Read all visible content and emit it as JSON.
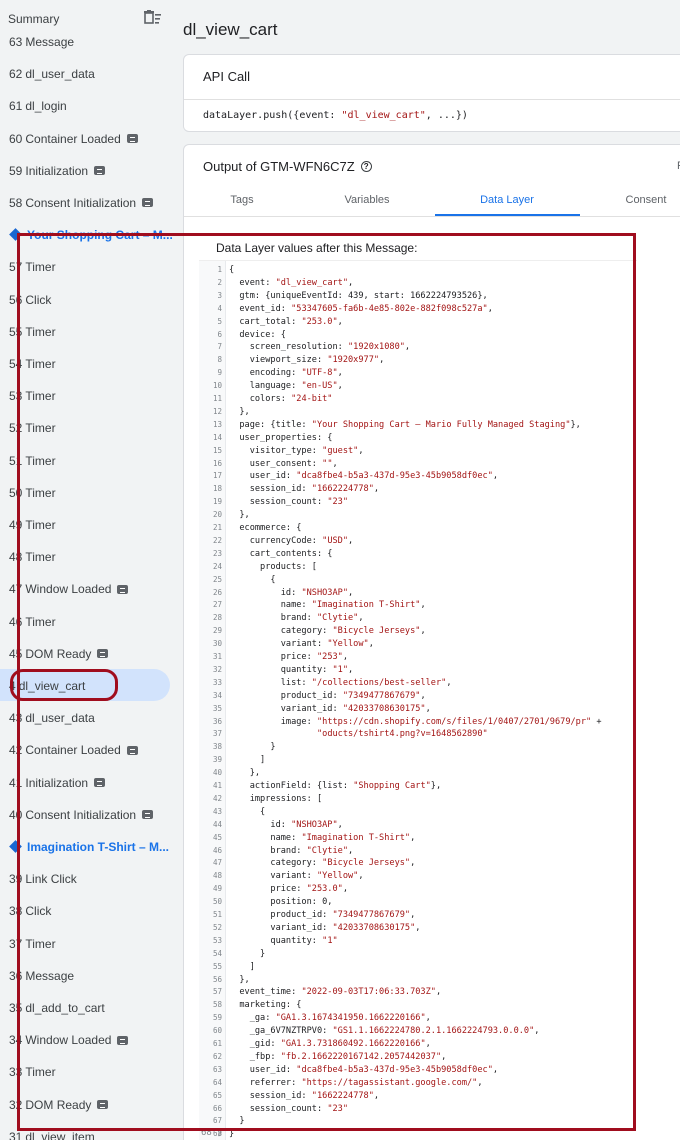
{
  "sidebar": {
    "title": "Summary",
    "clear_icon": "clear-list-icon",
    "items": [
      {
        "num": "63",
        "label": "Message",
        "badge": false,
        "type": "event"
      },
      {
        "num": "62",
        "label": "dl_user_data",
        "badge": false,
        "type": "event"
      },
      {
        "num": "61",
        "label": "dl_login",
        "badge": false,
        "type": "event"
      },
      {
        "num": "60",
        "label": "Container Loaded",
        "badge": true,
        "type": "event"
      },
      {
        "num": "59",
        "label": "Initialization",
        "badge": true,
        "type": "event"
      },
      {
        "num": "58",
        "label": "Consent Initialization",
        "badge": true,
        "type": "event"
      },
      {
        "num": "",
        "label": "Your Shopping Cart – M...",
        "badge": false,
        "type": "page"
      },
      {
        "num": "57",
        "label": "Timer",
        "badge": false,
        "type": "event"
      },
      {
        "num": "56",
        "label": "Click",
        "badge": false,
        "type": "event"
      },
      {
        "num": "55",
        "label": "Timer",
        "badge": false,
        "type": "event"
      },
      {
        "num": "54",
        "label": "Timer",
        "badge": false,
        "type": "event"
      },
      {
        "num": "53",
        "label": "Timer",
        "badge": false,
        "type": "event"
      },
      {
        "num": "52",
        "label": "Timer",
        "badge": false,
        "type": "event"
      },
      {
        "num": "51",
        "label": "Timer",
        "badge": false,
        "type": "event"
      },
      {
        "num": "50",
        "label": "Timer",
        "badge": false,
        "type": "event"
      },
      {
        "num": "49",
        "label": "Timer",
        "badge": false,
        "type": "event"
      },
      {
        "num": "48",
        "label": "Timer",
        "badge": false,
        "type": "event"
      },
      {
        "num": "47",
        "label": "Window Loaded",
        "badge": true,
        "type": "event"
      },
      {
        "num": "46",
        "label": "Timer",
        "badge": false,
        "type": "event"
      },
      {
        "num": "45",
        "label": "DOM Ready",
        "badge": true,
        "type": "event"
      },
      {
        "num": "4",
        "label": "dl_view_cart",
        "badge": false,
        "type": "selected"
      },
      {
        "num": "43",
        "label": "dl_user_data",
        "badge": false,
        "type": "event"
      },
      {
        "num": "42",
        "label": "Container Loaded",
        "badge": true,
        "type": "event"
      },
      {
        "num": "41",
        "label": "Initialization",
        "badge": true,
        "type": "event"
      },
      {
        "num": "40",
        "label": "Consent Initialization",
        "badge": true,
        "type": "event"
      },
      {
        "num": "",
        "label": "Imagination T-Shirt – M...",
        "badge": false,
        "type": "page"
      },
      {
        "num": "39",
        "label": "Link Click",
        "badge": false,
        "type": "event"
      },
      {
        "num": "38",
        "label": "Click",
        "badge": false,
        "type": "event"
      },
      {
        "num": "37",
        "label": "Timer",
        "badge": false,
        "type": "event"
      },
      {
        "num": "36",
        "label": "Message",
        "badge": false,
        "type": "event"
      },
      {
        "num": "35",
        "label": "dl_add_to_cart",
        "badge": false,
        "type": "event"
      },
      {
        "num": "34",
        "label": "Window Loaded",
        "badge": true,
        "type": "event"
      },
      {
        "num": "33",
        "label": "Timer",
        "badge": false,
        "type": "event"
      },
      {
        "num": "32",
        "label": "DOM Ready",
        "badge": true,
        "type": "event"
      },
      {
        "num": "31",
        "label": "dl_view_item",
        "badge": false,
        "type": "event"
      }
    ]
  },
  "main": {
    "title": "dl_view_cart",
    "api_call": {
      "heading": "API Call",
      "code_prefix": "dataLayer.push({event: ",
      "code_string": "\"dl_view_cart\"",
      "code_suffix": ", ...})"
    },
    "output": {
      "heading": "Output of GTM-WFN6C7Z",
      "help_icon": "help-circle-icon",
      "overflow_char": "F",
      "tabs": [
        "Tags",
        "Variables",
        "Data Layer",
        "Consent"
      ],
      "active_tab": "Data Layer",
      "data_layer_label": "Data Layer values after this Message:",
      "code_lines": [
        "{",
        "  event: \"dl_view_cart\",",
        "  gtm: {uniqueEventId: 439, start: 1662224793526},",
        "  event_id: \"53347605-fa6b-4e85-802e-882f098c527a\",",
        "  cart_total: \"253.0\",",
        "  device: {",
        "    screen_resolution: \"1920x1080\",",
        "    viewport_size: \"1920x977\",",
        "    encoding: \"UTF-8\",",
        "    language: \"en-US\",",
        "    colors: \"24-bit\"",
        "  },",
        "  page: {title: \"Your Shopping Cart – Mario Fully Managed Staging\"},",
        "  user_properties: {",
        "    visitor_type: \"guest\",",
        "    user_consent: \"\",",
        "    user_id: \"dca8fbe4-b5a3-437d-95e3-45b9058df0ec\",",
        "    session_id: \"1662224778\",",
        "    session_count: \"23\"",
        "  },",
        "  ecommerce: {",
        "    currencyCode: \"USD\",",
        "    cart_contents: {",
        "      products: [",
        "        {",
        "          id: \"NSHO3AP\",",
        "          name: \"Imagination T-Shirt\",",
        "          brand: \"Clytie\",",
        "          category: \"Bicycle Jerseys\",",
        "          variant: \"Yellow\",",
        "          price: \"253\",",
        "          quantity: \"1\",",
        "          list: \"/collections/best-seller\",",
        "          product_id: \"7349477867679\",",
        "          variant_id: \"42033708630175\",",
        "          image: \"https://cdn.shopify.com/s/files/1/0407/2701/9679/pr\" +",
        "                 \"oducts/tshirt4.png?v=1648562890\"",
        "        }",
        "      ]",
        "    },",
        "    actionField: {list: \"Shopping Cart\"},",
        "    impressions: [",
        "      {",
        "        id: \"NSHO3AP\",",
        "        name: \"Imagination T-Shirt\",",
        "        brand: \"Clytie\",",
        "        category: \"Bicycle Jerseys\",",
        "        variant: \"Yellow\",",
        "        price: \"253.0\",",
        "        position: 0,",
        "        product_id: \"7349477867679\",",
        "        variant_id: \"42033708630175\",",
        "        quantity: \"1\"",
        "      }",
        "    ]",
        "  },",
        "  event_time: \"2022-09-03T17:06:33.703Z\",",
        "  marketing: {",
        "    _ga: \"GA1.3.1674341950.1662220166\",",
        "    _ga_6V7NZTRPV0: \"GS1.1.1662224780.2.1.1662224793.0.0.0\",",
        "    _gid: \"GA1.3.731860492.1662220166\",",
        "    _fbp: \"fb.2.1662220167142.2057442037\",",
        "    user_id: \"dca8fbe4-b5a3-437d-95e3-45b9058df0ec\",",
        "    referrer: \"https://tagassistant.google.com/\",",
        "    session_id: \"1662224778\",",
        "    session_count: \"23\"",
        "  }",
        "}"
      ],
      "tail_line": "68 }"
    }
  },
  "colors": {
    "accent": "#1a73e8",
    "highlight_frame": "#a00d1e",
    "selected_bg": "#d2e3fc",
    "string": "#a31515"
  }
}
